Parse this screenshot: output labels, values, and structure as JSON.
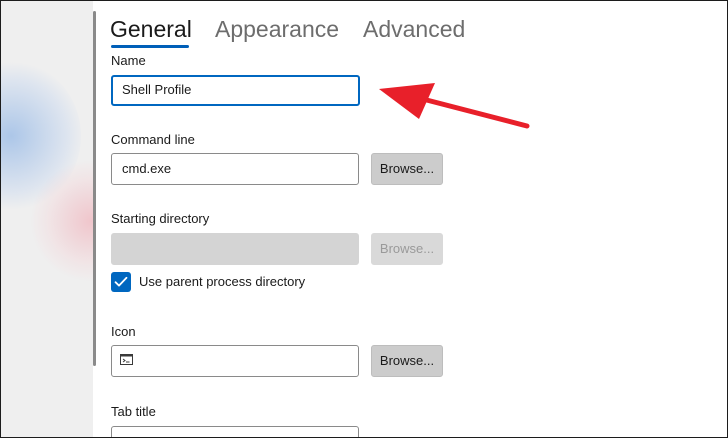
{
  "tabs": [
    {
      "label": "General"
    },
    {
      "label": "Appearance"
    },
    {
      "label": "Advanced"
    }
  ],
  "fields": {
    "name": {
      "label": "Name",
      "value": "Shell Profile"
    },
    "command_line": {
      "label": "Command line",
      "value": "cmd.exe",
      "browse_label": "Browse..."
    },
    "starting_directory": {
      "label": "Starting directory",
      "value": "",
      "browse_label": "Browse..."
    },
    "use_parent_process_directory": {
      "label": "Use parent process directory",
      "checked": true
    },
    "icon": {
      "label": "Icon",
      "value": "",
      "browse_label": "Browse..."
    },
    "tab_title": {
      "label": "Tab title",
      "value": ""
    }
  },
  "colors": {
    "accent": "#0067c0",
    "annotation_arrow": "#e8202a"
  },
  "icons": {
    "icon_field_glyph": "console-icon",
    "checkbox_mark": "checkmark-icon",
    "annotation": "red-arrow-annotation"
  }
}
